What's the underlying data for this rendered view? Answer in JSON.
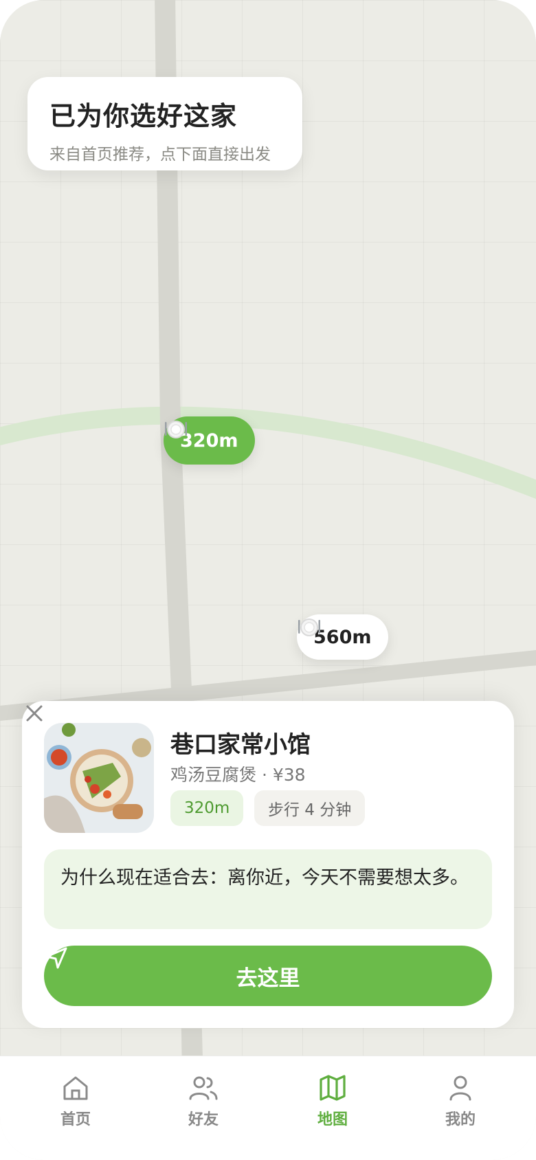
{
  "header": {
    "title": "已为你选好这家",
    "subtitle": "来自首页推荐，点下面直接出发"
  },
  "map": {
    "pins": [
      {
        "icon": "plate-icon",
        "label": "320m",
        "selected": true
      },
      {
        "icon": "plate-icon",
        "label": "560m",
        "selected": false
      }
    ]
  },
  "restaurant": {
    "name": "巷口家常小馆",
    "dish_price": "鸡汤豆腐煲 · ¥38",
    "distance": "320m",
    "walk_time": "步行 4 分钟",
    "reason": "为什么现在适合去：离你近，今天不需要想太多。",
    "go_label": "去这里",
    "thumbnail_icon": "food-bowl-photo"
  },
  "tabs": [
    {
      "label": "首页",
      "icon": "home-icon",
      "active": false
    },
    {
      "label": "好友",
      "icon": "friends-icon",
      "active": false
    },
    {
      "label": "地图",
      "icon": "map-icon",
      "active": true
    },
    {
      "label": "我的",
      "icon": "user-icon",
      "active": false
    }
  ],
  "colors": {
    "accent": "#6bbb4a",
    "accent_soft": "#edf6e7",
    "map_bg": "#ecece6"
  }
}
